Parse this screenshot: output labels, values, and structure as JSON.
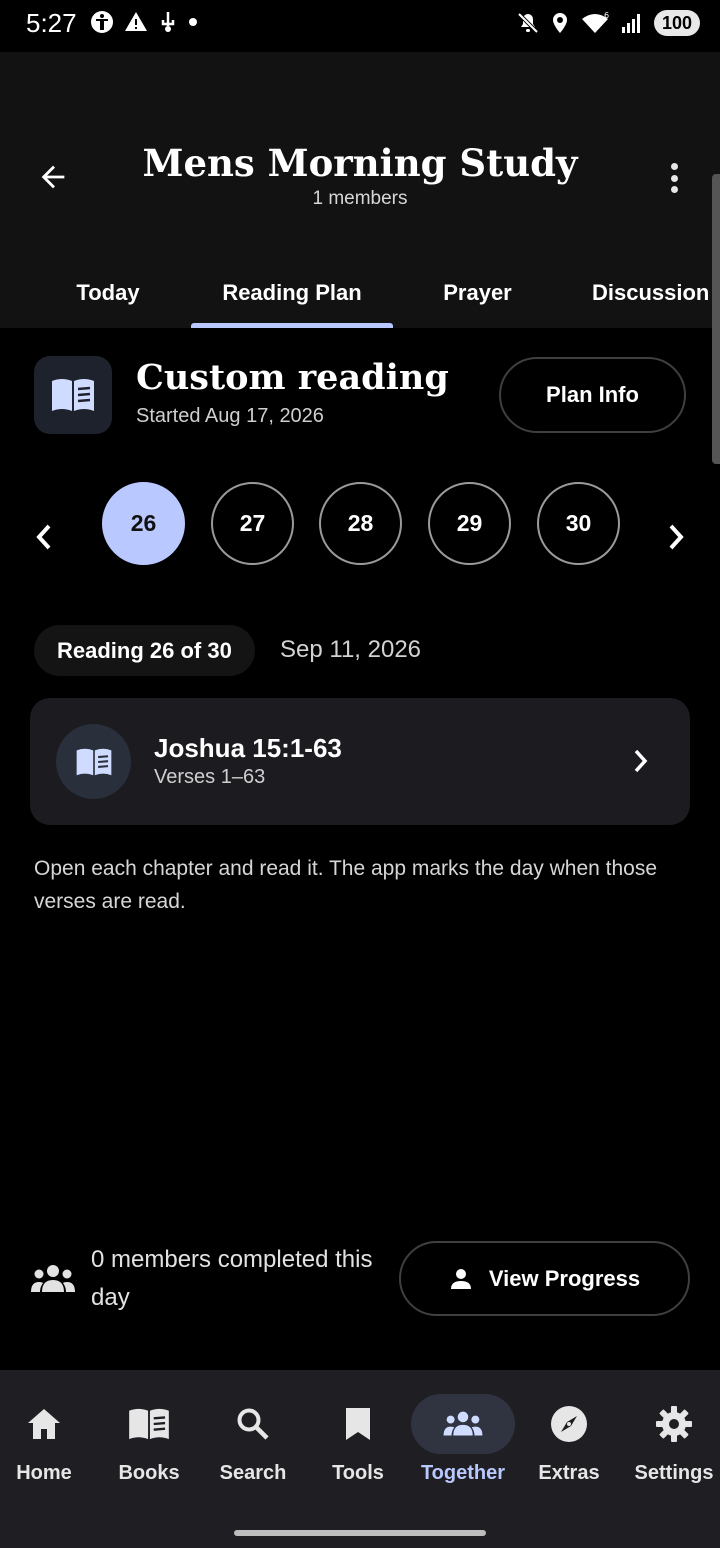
{
  "status_bar": {
    "time": "5:27",
    "battery": "100",
    "network": "6"
  },
  "app_bar": {
    "title": "Mens Morning Study",
    "subtitle": "1 members"
  },
  "tabs": [
    {
      "label": "Today",
      "active": false
    },
    {
      "label": "Reading Plan",
      "active": true
    },
    {
      "label": "Prayer",
      "active": false
    },
    {
      "label": "Discussion",
      "active": false
    }
  ],
  "plan": {
    "title": "Custom reading",
    "started": "Started Aug 17, 2026",
    "info_button": "Plan Info"
  },
  "days": {
    "items": [
      "26",
      "27",
      "28",
      "29",
      "30"
    ],
    "selected": "26"
  },
  "reading": {
    "chip": "Reading 26 of 30",
    "date": "Sep 11, 2026",
    "card_title": "Joshua 15:1-63",
    "card_subtitle": "Verses 1–63",
    "instructions": "Open each chapter and read it. The app marks the day when those verses are read."
  },
  "progress": {
    "members_text": "0 members completed this day",
    "button_label": "View Progress"
  },
  "bottom_nav": [
    {
      "label": "Home",
      "icon": "home-icon",
      "active": false
    },
    {
      "label": "Books",
      "icon": "book-icon",
      "active": false
    },
    {
      "label": "Search",
      "icon": "search-icon",
      "active": false
    },
    {
      "label": "Tools",
      "icon": "bookmark-icon",
      "active": false
    },
    {
      "label": "Together",
      "icon": "group-icon",
      "active": true
    },
    {
      "label": "Extras",
      "icon": "compass-icon",
      "active": false
    },
    {
      "label": "Settings",
      "icon": "gear-icon",
      "active": false
    }
  ],
  "colors": {
    "accent": "#b9c8ff",
    "background": "#000000",
    "app_bar": "#121212",
    "card": "#1c1b20",
    "nav": "#1f1e23"
  }
}
